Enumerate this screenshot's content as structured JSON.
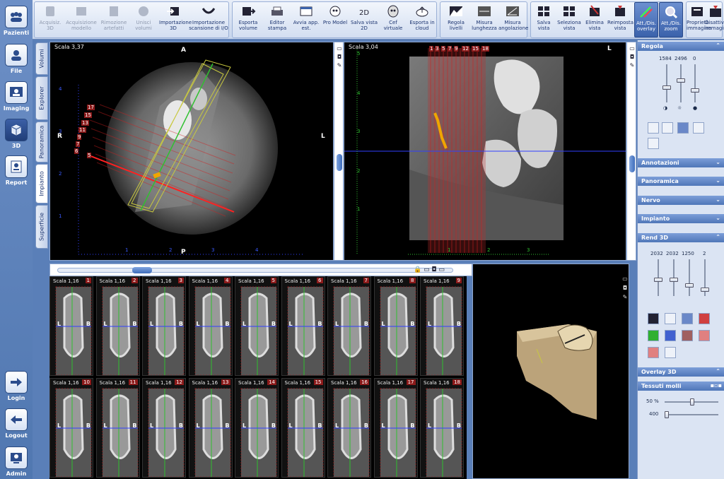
{
  "left_rail": {
    "items": [
      {
        "id": "pazienti",
        "label": "Pazienti"
      },
      {
        "id": "file",
        "label": "File"
      },
      {
        "id": "imaging",
        "label": "Imaging"
      },
      {
        "id": "3d",
        "label": "3D"
      },
      {
        "id": "report",
        "label": "Report"
      },
      {
        "id": "login",
        "label": "Login"
      },
      {
        "id": "logout",
        "label": "Logout"
      },
      {
        "id": "admin",
        "label": "Admin"
      }
    ]
  },
  "toolbar": {
    "groups": [
      {
        "buttons": [
          {
            "label": "Acquisiz. 3D",
            "icon": "acquisition-icon",
            "disabled": true
          },
          {
            "label": "Acquisizione modello",
            "icon": "model-acquisition-icon",
            "disabled": true
          },
          {
            "label": "Rimozione artefatti",
            "icon": "artifact-removal-icon",
            "disabled": true
          },
          {
            "label": "Unisci volumi",
            "icon": "merge-volumes-icon",
            "disabled": true
          },
          {
            "label": "Importazione 3D",
            "icon": "import-3d-icon",
            "disabled": false
          },
          {
            "label": "Importazione scansione di I/O",
            "icon": "import-scan-icon",
            "disabled": false
          }
        ]
      },
      {
        "buttons": [
          {
            "label": "Esporta volume",
            "icon": "export-volume-icon"
          },
          {
            "label": "Editor stampa",
            "icon": "print-editor-icon"
          },
          {
            "label": "Avvia app. est.",
            "icon": "external-app-icon"
          },
          {
            "label": "Pro Model",
            "icon": "pro-model-icon"
          },
          {
            "label": "Salva vista 2D",
            "icon": "save-2d-icon"
          },
          {
            "label": "Cef virtuale",
            "icon": "virtual-ceph-icon"
          },
          {
            "label": "Esporta in cloud",
            "icon": "cloud-export-icon"
          }
        ]
      },
      {
        "buttons": [
          {
            "label": "Regola livelli",
            "icon": "levels-icon"
          },
          {
            "label": "Misura lunghezza",
            "icon": "measure-length-icon"
          },
          {
            "label": "Misura angolazione",
            "icon": "measure-angle-icon"
          }
        ]
      },
      {
        "buttons": [
          {
            "label": "Salva vista",
            "icon": "save-view-icon"
          },
          {
            "label": "Seleziona vista",
            "icon": "select-view-icon"
          },
          {
            "label": "Elimina vista",
            "icon": "delete-view-icon"
          },
          {
            "label": "Reimposta vista",
            "icon": "reset-view-icon"
          },
          {
            "label": "Att./Dis. overlay",
            "icon": "overlay-toggle-icon",
            "active": true
          },
          {
            "label": "Att./Dis. zoom",
            "icon": "zoom-toggle-icon",
            "active": true
          }
        ]
      },
      {
        "buttons": [
          {
            "label": "Proprietà immagine",
            "icon": "image-properties-icon"
          },
          {
            "label": "Disattiva immagine",
            "icon": "disable-image-icon"
          }
        ]
      }
    ]
  },
  "vtabs": [
    "Volumi",
    "Explorer",
    "Panoramica",
    "Impianto",
    "Superficie"
  ],
  "vtabs_active": "Impianto",
  "axial_view": {
    "scale": "Scala 3,37",
    "orient_top": "A",
    "orient_bottom": "P",
    "orient_left": "R",
    "orient_right": "L",
    "slice_numbers": [
      "17",
      "15",
      "13",
      "11",
      "9",
      "7",
      "6",
      "5"
    ],
    "ruler_left": [
      "4",
      "3",
      "2",
      "1"
    ],
    "ruler_bottom": [
      "1",
      "2",
      "3",
      "4"
    ]
  },
  "sagittal_view": {
    "scale": "Scala 3,04",
    "orient_right": "L",
    "slice_numbers": [
      "1",
      "3",
      "5",
      "7",
      "9",
      "12",
      "15",
      "18"
    ],
    "ruler_left": [
      "5",
      "4",
      "3",
      "2",
      "1"
    ],
    "ruler_bottom": [
      "1",
      "2",
      "3"
    ]
  },
  "thumbs": {
    "scale": "Scala 1,16",
    "left_marker": "L",
    "right_marker": "B",
    "numbers": [
      "1",
      "2",
      "3",
      "4",
      "5",
      "6",
      "7",
      "8",
      "9",
      "10",
      "11",
      "12",
      "13",
      "14",
      "15",
      "16",
      "17",
      "18"
    ]
  },
  "right_panel": {
    "regola": {
      "title": "Regola",
      "values": [
        "1584",
        "2496",
        "0"
      ]
    },
    "annotazioni": "Annotazioni",
    "panoramica": "Panoramica",
    "nervo": "Nervo",
    "impianto": "Impianto",
    "rend3d": {
      "title": "Rend 3D",
      "values": [
        "2032",
        "2032",
        "1250",
        "2"
      ]
    },
    "overlay3d": "Overlay 3D",
    "tessuti": {
      "title": "Tessuti molli",
      "opacity": "50 %",
      "value": "400"
    }
  },
  "colors": {
    "accent": "#4f76b8",
    "implant": "#f0a500",
    "guide_red": "#d02020",
    "guide_green": "#30c030",
    "guide_blue": "#3040ff"
  }
}
